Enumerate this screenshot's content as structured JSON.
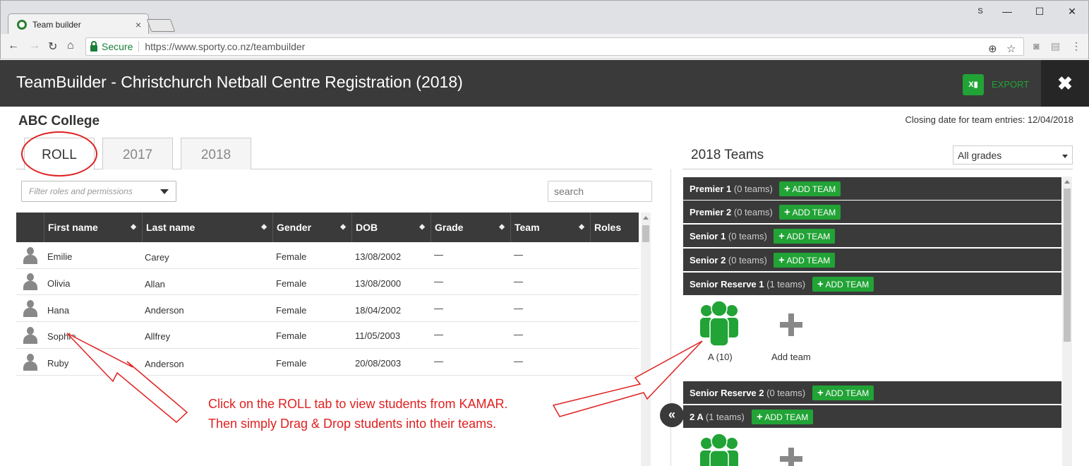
{
  "browser": {
    "tab_title": "Team builder",
    "secure_label": "Secure",
    "url": "https://www.sporty.co.nz/teambuilder",
    "profile_initial": "S"
  },
  "header": {
    "title": "TeamBuilder - Christchurch Netball Centre Registration (2018)",
    "export_label": "EXPORT",
    "close_label": "✖"
  },
  "school": "ABC College",
  "closing_date": "Closing date for team entries: 12/04/2018",
  "tabs": [
    {
      "label": "ROLL"
    },
    {
      "label": "2017"
    },
    {
      "label": "2018"
    }
  ],
  "filter_placeholder": "Filter roles and permissions",
  "search_placeholder": "search",
  "columns": [
    "First name",
    "Last name",
    "Gender",
    "DOB",
    "Grade",
    "Team",
    "Roles"
  ],
  "students": [
    {
      "first": "Emilie",
      "last": "Carey",
      "gender": "Female",
      "dob": "13/08/2002",
      "grade": "—",
      "team": "—"
    },
    {
      "first": "Olivia",
      "last": "Allan",
      "gender": "Female",
      "dob": "13/08/2000",
      "grade": "—",
      "team": "—"
    },
    {
      "first": "Hana",
      "last": "Anderson",
      "gender": "Female",
      "dob": "18/04/2002",
      "grade": "—",
      "team": "—"
    },
    {
      "first": "Sophie",
      "last": "Allfrey",
      "gender": "Female",
      "dob": "11/05/2003",
      "grade": "—",
      "team": "—"
    },
    {
      "first": "Ruby",
      "last": "Anderson",
      "gender": "Female",
      "dob": "20/08/2003",
      "grade": "—",
      "team": "—"
    }
  ],
  "annotation": {
    "line1": "Click on the ROLL tab to view students from KAMAR.",
    "line2": "Then simply Drag & Drop students into their teams."
  },
  "teams_panel": {
    "heading": "2018 Teams",
    "grade_filter": "All grades",
    "add_team_label": "ADD TEAM",
    "add_team_tile": "Add team",
    "collapse_label": "«",
    "grades": [
      {
        "name": "Premier 1",
        "count": "(0 teams)"
      },
      {
        "name": "Premier 2",
        "count": "(0 teams)"
      },
      {
        "name": "Senior 1",
        "count": "(0 teams)"
      },
      {
        "name": "Senior 2",
        "count": "(0 teams)"
      },
      {
        "name": "Senior Reserve 1",
        "count": "(1 teams)"
      },
      {
        "name": "Senior Reserve 2",
        "count": "(0 teams)"
      },
      {
        "name": "2 A",
        "count": "(1 teams)"
      }
    ],
    "team_tile": "A (10)"
  },
  "colors": {
    "header_bg": "#3a3a3a",
    "accent_green": "#21a336",
    "annotation_red": "#e02020"
  }
}
